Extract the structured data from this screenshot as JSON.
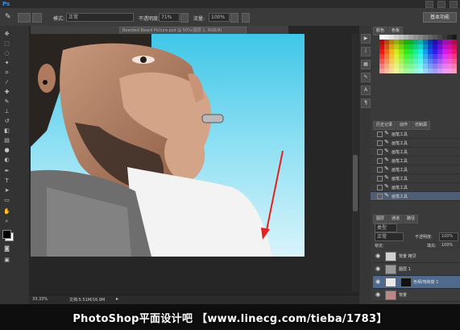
{
  "app": {
    "logo": "Ps"
  },
  "options_bar": {
    "mode_label": "模式:",
    "mode_value": "正常",
    "opacity_label": "不透明度:",
    "opacity_value": "71%",
    "flow_label": "流量:",
    "flow_value": "100%",
    "workspace": "基本功能"
  },
  "document": {
    "tab_title": "Bearded Beard Picture.psd @ 50%(图层 1, RGB/8)",
    "zoom": "33.33%",
    "doc_info": "文档:5.51M/16.9M"
  },
  "panels": {
    "top_tabs": [
      "颜色",
      "色板"
    ],
    "history_tabs": [
      "历史记录",
      "动作",
      "仿制源"
    ],
    "history_items": [
      "画笔工具",
      "画笔工具",
      "画笔工具",
      "画笔工具",
      "画笔工具",
      "画笔工具",
      "画笔工具",
      "画笔工具"
    ],
    "layers_tabs": [
      "图层",
      "通道",
      "路径"
    ],
    "kind_label": "类型",
    "blend_mode": "正常",
    "opacity_label": "不透明度:",
    "opacity_value": "100%",
    "lock_label": "锁定:",
    "fill_label": "填充:",
    "fill_value": "100%",
    "layers": [
      "背景 拷贝",
      "图层 1",
      "色相/饱和度 1",
      "背景"
    ]
  },
  "watermark": {
    "text": "PhotoShop平面设计吧  【www.linecg.com/tieba/1783】"
  },
  "colors": {
    "accent_blue": "#3d8fe0",
    "arrow_red": "#e8201c",
    "canvas_sky": "#5ad3ee"
  }
}
